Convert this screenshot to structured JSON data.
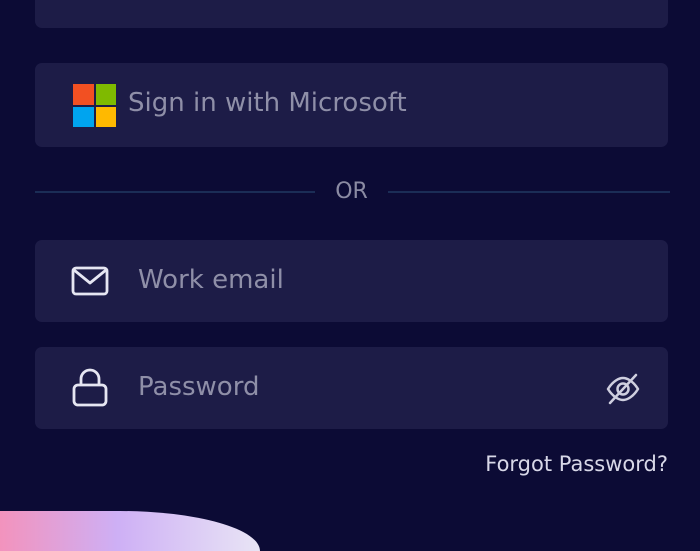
{
  "social": {
    "microsoft_label": "Sign in with Microsoft"
  },
  "divider": {
    "label": "OR"
  },
  "email": {
    "placeholder": "Work email",
    "value": ""
  },
  "password": {
    "placeholder": "Password",
    "value": ""
  },
  "links": {
    "forgot": "Forgot Password?"
  },
  "icons": {
    "google": "google-icon",
    "microsoft": "microsoft-logo-icon",
    "mail": "mail-icon",
    "lock": "lock-icon",
    "eye_off": "eye-off-icon"
  },
  "colors": {
    "background": "#0c0b35",
    "card": "#1d1c47",
    "placeholder": "#8f8fa8",
    "divider": "#1b2d56",
    "link": "#d8d8e8"
  }
}
